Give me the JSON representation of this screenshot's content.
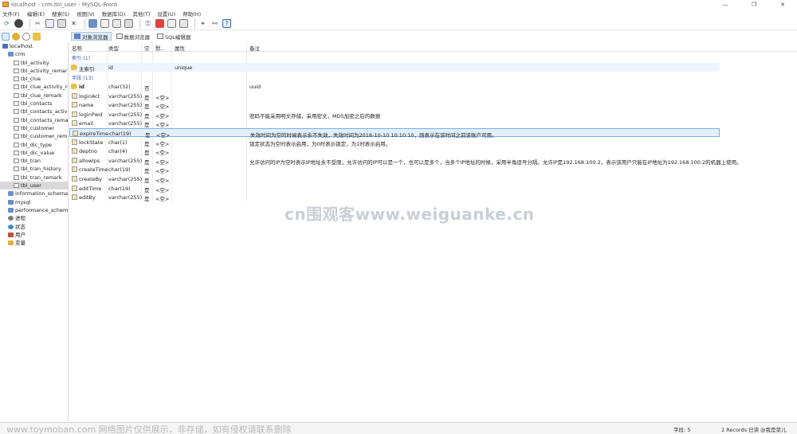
{
  "window": {
    "title": "localhost - crm.tbl_user - MySQL-Front"
  },
  "menu": [
    "文件(F)",
    "编辑(E)",
    "搜索(S)",
    "视图(V)",
    "数据库(D)",
    "其他(T)",
    "设置(U)",
    "帮助(H)"
  ],
  "tabs": [
    {
      "label": "对象浏览器",
      "active": true
    },
    {
      "label": "数据浏览器",
      "active": false
    },
    {
      "label": "SQL编辑器",
      "active": false
    }
  ],
  "tree": [
    {
      "label": "localhost",
      "icon": "host",
      "level": 0
    },
    {
      "label": "crm",
      "icon": "db",
      "level": 1
    },
    {
      "label": "tbl_activity",
      "icon": "tbl",
      "level": 2
    },
    {
      "label": "tbl_activity_remark",
      "icon": "tbl",
      "level": 2
    },
    {
      "label": "tbl_clue",
      "icon": "tbl",
      "level": 2
    },
    {
      "label": "tbl_clue_activity_rela",
      "icon": "tbl",
      "level": 2
    },
    {
      "label": "tbl_clue_remark",
      "icon": "tbl",
      "level": 2
    },
    {
      "label": "tbl_contacts",
      "icon": "tbl",
      "level": 2
    },
    {
      "label": "tbl_contacts_activity",
      "icon": "tbl",
      "level": 2
    },
    {
      "label": "tbl_contacts_remark",
      "icon": "tbl",
      "level": 2
    },
    {
      "label": "tbl_customer",
      "icon": "tbl",
      "level": 2
    },
    {
      "label": "tbl_customer_remar",
      "icon": "tbl",
      "level": 2
    },
    {
      "label": "tbl_dic_type",
      "icon": "tbl",
      "level": 2
    },
    {
      "label": "tbl_dic_value",
      "icon": "tbl",
      "level": 2
    },
    {
      "label": "tbl_tran",
      "icon": "tbl",
      "level": 2
    },
    {
      "label": "tbl_tran_history",
      "icon": "tbl",
      "level": 2
    },
    {
      "label": "tbl_tran_remark",
      "icon": "tbl",
      "level": 2
    },
    {
      "label": "tbl_user",
      "icon": "tbl",
      "level": 2,
      "selected": true
    },
    {
      "label": "information_schema",
      "icon": "db",
      "level": 1
    },
    {
      "label": "mysql",
      "icon": "db",
      "level": 1
    },
    {
      "label": "performance_schema",
      "icon": "db",
      "level": 1
    },
    {
      "label": "进程",
      "icon": "proc",
      "level": 1
    },
    {
      "label": "状态",
      "icon": "stat",
      "level": 1
    },
    {
      "label": "用户",
      "icon": "user",
      "level": 1
    },
    {
      "label": "变量",
      "icon": "var",
      "level": 1
    }
  ],
  "columns": {
    "name": "名称",
    "type": "类型",
    "null": "空",
    "default": "默...",
    "attr": "属性",
    "comment": "备注"
  },
  "groups": {
    "index": "索引 (1)",
    "fields": "字段 (13)"
  },
  "index_rows": [
    {
      "name": "主索引",
      "type": "id",
      "null": "",
      "default": "",
      "attr": "unique",
      "comment": ""
    }
  ],
  "field_rows": [
    {
      "name": "id",
      "type": "char(32)",
      "null": "否",
      "default": "",
      "attr": "",
      "comment": "uuid",
      "key": true
    },
    {
      "name": "loginAct",
      "type": "varchar(255)",
      "null": "是",
      "default": "<空>",
      "attr": "",
      "comment": ""
    },
    {
      "name": "name",
      "type": "varchar(255)",
      "null": "是",
      "default": "<空>",
      "attr": "",
      "comment": ""
    },
    {
      "name": "loginPwd",
      "type": "varchar(255)",
      "null": "是",
      "default": "<空>",
      "attr": "",
      "comment": "密码不能采用明文存储，采用密文，MD5加密之后的数据"
    },
    {
      "name": "email",
      "type": "varchar(255)",
      "null": "是",
      "default": "<空>",
      "attr": "",
      "comment": ""
    },
    {
      "name": "expireTime",
      "type": "char(19)",
      "null": "是",
      "default": "<空>",
      "attr": "",
      "comment": "失效时间为空的时候表示永不失效，失效时间为2018-10-10 10:10:10，则表示在该时间之前该账户可用。",
      "highlight": true
    },
    {
      "name": "lockState",
      "type": "char(1)",
      "null": "是",
      "default": "<空>",
      "attr": "",
      "comment": "锁定状态为空时表示启用，为0时表示锁定，为1时表示启用。"
    },
    {
      "name": "deptno",
      "type": "char(4)",
      "null": "是",
      "default": "<空>",
      "attr": "",
      "comment": ""
    },
    {
      "name": "allowIps",
      "type": "varchar(255)",
      "null": "是",
      "default": "<空>",
      "attr": "",
      "comment": "允许访问的IP为空时表示IP地址永不受限，允许访问的IP可以是一个，也可以是多个，当多个IP地址的时候，采用半角逗号分隔。允许IP是192.168.100.2，表示该用户只能在IP地址为192.168.100.2的机器上使用。"
    },
    {
      "name": "createTime",
      "type": "char(19)",
      "null": "是",
      "default": "<空>",
      "attr": "",
      "comment": ""
    },
    {
      "name": "createBy",
      "type": "varchar(255)",
      "null": "是",
      "default": "<空>",
      "attr": "",
      "comment": ""
    },
    {
      "name": "editTime",
      "type": "char(19)",
      "null": "是",
      "default": "<空>",
      "attr": "",
      "comment": ""
    },
    {
      "name": "editBy",
      "type": "varchar(255)",
      "null": "是",
      "default": "<空>",
      "attr": "",
      "comment": ""
    }
  ],
  "status": {
    "left": "www.toymoban.com 网络图片仅供展示，非存储，如有侵权请联系删除",
    "fields": "字段: 5",
    "records": "2 Records 已读 @我是菜儿"
  },
  "watermark": "cn围观客www.weiguanke.cn"
}
